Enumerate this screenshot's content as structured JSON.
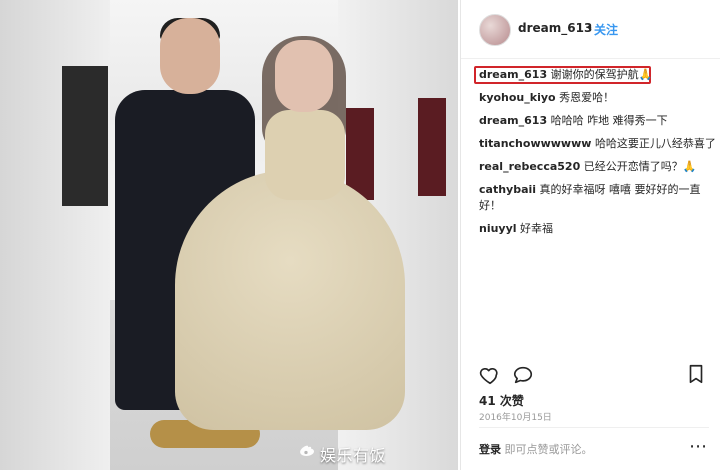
{
  "post": {
    "username": "dream_613",
    "separator": "•",
    "follow_label": "关注",
    "comments": [
      {
        "user": "dream_613",
        "text": "谢谢你的保驾护航🙏"
      },
      {
        "user": "kyohou_kiyo",
        "text": "秀恩爱哈！"
      },
      {
        "user": "dream_613",
        "text": "哈哈哈 咋地 难得秀一下"
      },
      {
        "user": "titanchowwwwww",
        "text": "哈哈这要正儿八经恭喜了"
      },
      {
        "user": "real_rebecca520",
        "text": "已经公开恋情了吗？🙏"
      },
      {
        "user": "cathybaii",
        "text": "真的好幸福呀 嘻嘻 要好好的一直好！"
      },
      {
        "user": "niuyyl",
        "text": "好幸福"
      }
    ],
    "likes_label": "41 次赞",
    "date_label": "2016年10月15日",
    "login": {
      "link": "登录",
      "rest": "即可点赞或评论。"
    },
    "more_label": "⋯"
  },
  "watermark": {
    "text": "娱乐有饭"
  },
  "icons": {
    "heart": "heart-icon",
    "comment": "comment-icon",
    "bookmark": "bookmark-icon",
    "weibo": "weibo-icon"
  }
}
